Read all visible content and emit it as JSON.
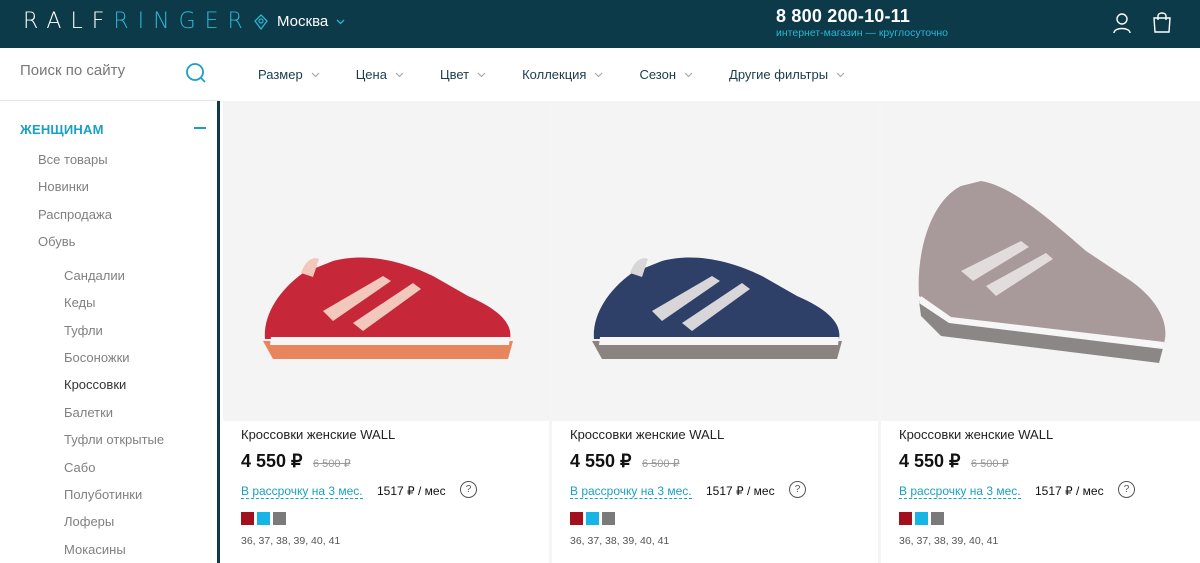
{
  "header": {
    "logo_left": "RALF",
    "logo_right": "RINGER",
    "city": "Москва",
    "phone": "8 800 200-10-11",
    "phone_sub": "интернет-магазин — круглосуточно"
  },
  "search": {
    "placeholder": "Поиск по сайту"
  },
  "filters": [
    "Размер",
    "Цена",
    "Цвет",
    "Коллекция",
    "Сезон",
    "Другие фильтры"
  ],
  "sidebar": {
    "category": "ЖЕНЩИНАМ",
    "items": [
      "Все товары",
      "Новинки",
      "Распродажа",
      "Обувь"
    ],
    "sub_items": [
      "Сандалии",
      "Кеды",
      "Туфли",
      "Босоножки",
      "Кроссовки",
      "Балетки",
      "Туфли открытые",
      "Сабо",
      "Полуботинки",
      "Лоферы",
      "Мокасины"
    ],
    "selected": "Кроссовки"
  },
  "products": [
    {
      "title": "Кроссовки женские WALL",
      "price": "4 550 ₽",
      "old_price": "6 500 ₽",
      "installment": "В рассрочку на 3 мес.",
      "monthly": "1517 ₽ / мес",
      "help": "?",
      "sizes": "36, 37, 38, 39, 40, 41",
      "shoe_color": "#c6283a"
    },
    {
      "title": "Кроссовки женские WALL",
      "price": "4 550 ₽",
      "old_price": "6 500 ₽",
      "installment": "В рассрочку на 3 мес.",
      "monthly": "1517 ₽ / мес",
      "help": "?",
      "sizes": "36, 37, 38, 39, 40, 41",
      "shoe_color": "#2e3f68"
    },
    {
      "title": "Кроссовки женские WALL",
      "price": "4 550 ₽",
      "old_price": "6 500 ₽",
      "installment": "В рассрочку на 3 мес.",
      "monthly": "1517 ₽ / мес",
      "help": "?",
      "sizes": "36, 37, 38, 39, 40, 41",
      "shoe_color": "#a89a9a"
    }
  ],
  "swatch_colors": [
    "#a3101d",
    "#16b5e6",
    "#7a7a7a"
  ],
  "colors": {
    "header_bg": "#0c3a49",
    "accent": "#1aa0c2"
  }
}
